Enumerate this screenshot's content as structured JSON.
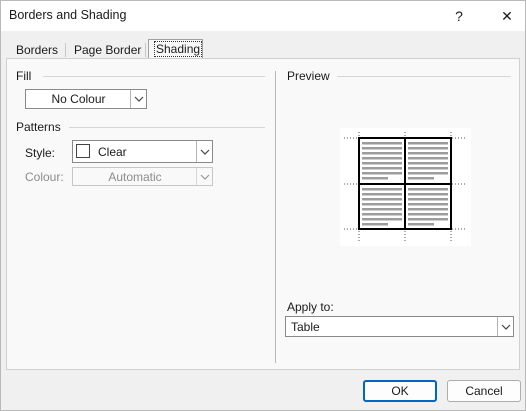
{
  "window": {
    "title": "Borders and Shading",
    "help_label": "?",
    "close_label": "✕"
  },
  "tabs": [
    {
      "label": "Borders",
      "active": false
    },
    {
      "label": "Page Border",
      "active": false
    },
    {
      "label": "Shading",
      "active": true
    }
  ],
  "fill": {
    "label": "Fill",
    "value": "No Colour"
  },
  "patterns": {
    "label": "Patterns",
    "style_label": "Style:",
    "style_value": "Clear",
    "colour_label": "Colour:",
    "colour_value": "Automatic"
  },
  "preview": {
    "label": "Preview"
  },
  "apply_to": {
    "label": "Apply to:",
    "value": "Table"
  },
  "buttons": {
    "ok": "OK",
    "cancel": "Cancel"
  }
}
